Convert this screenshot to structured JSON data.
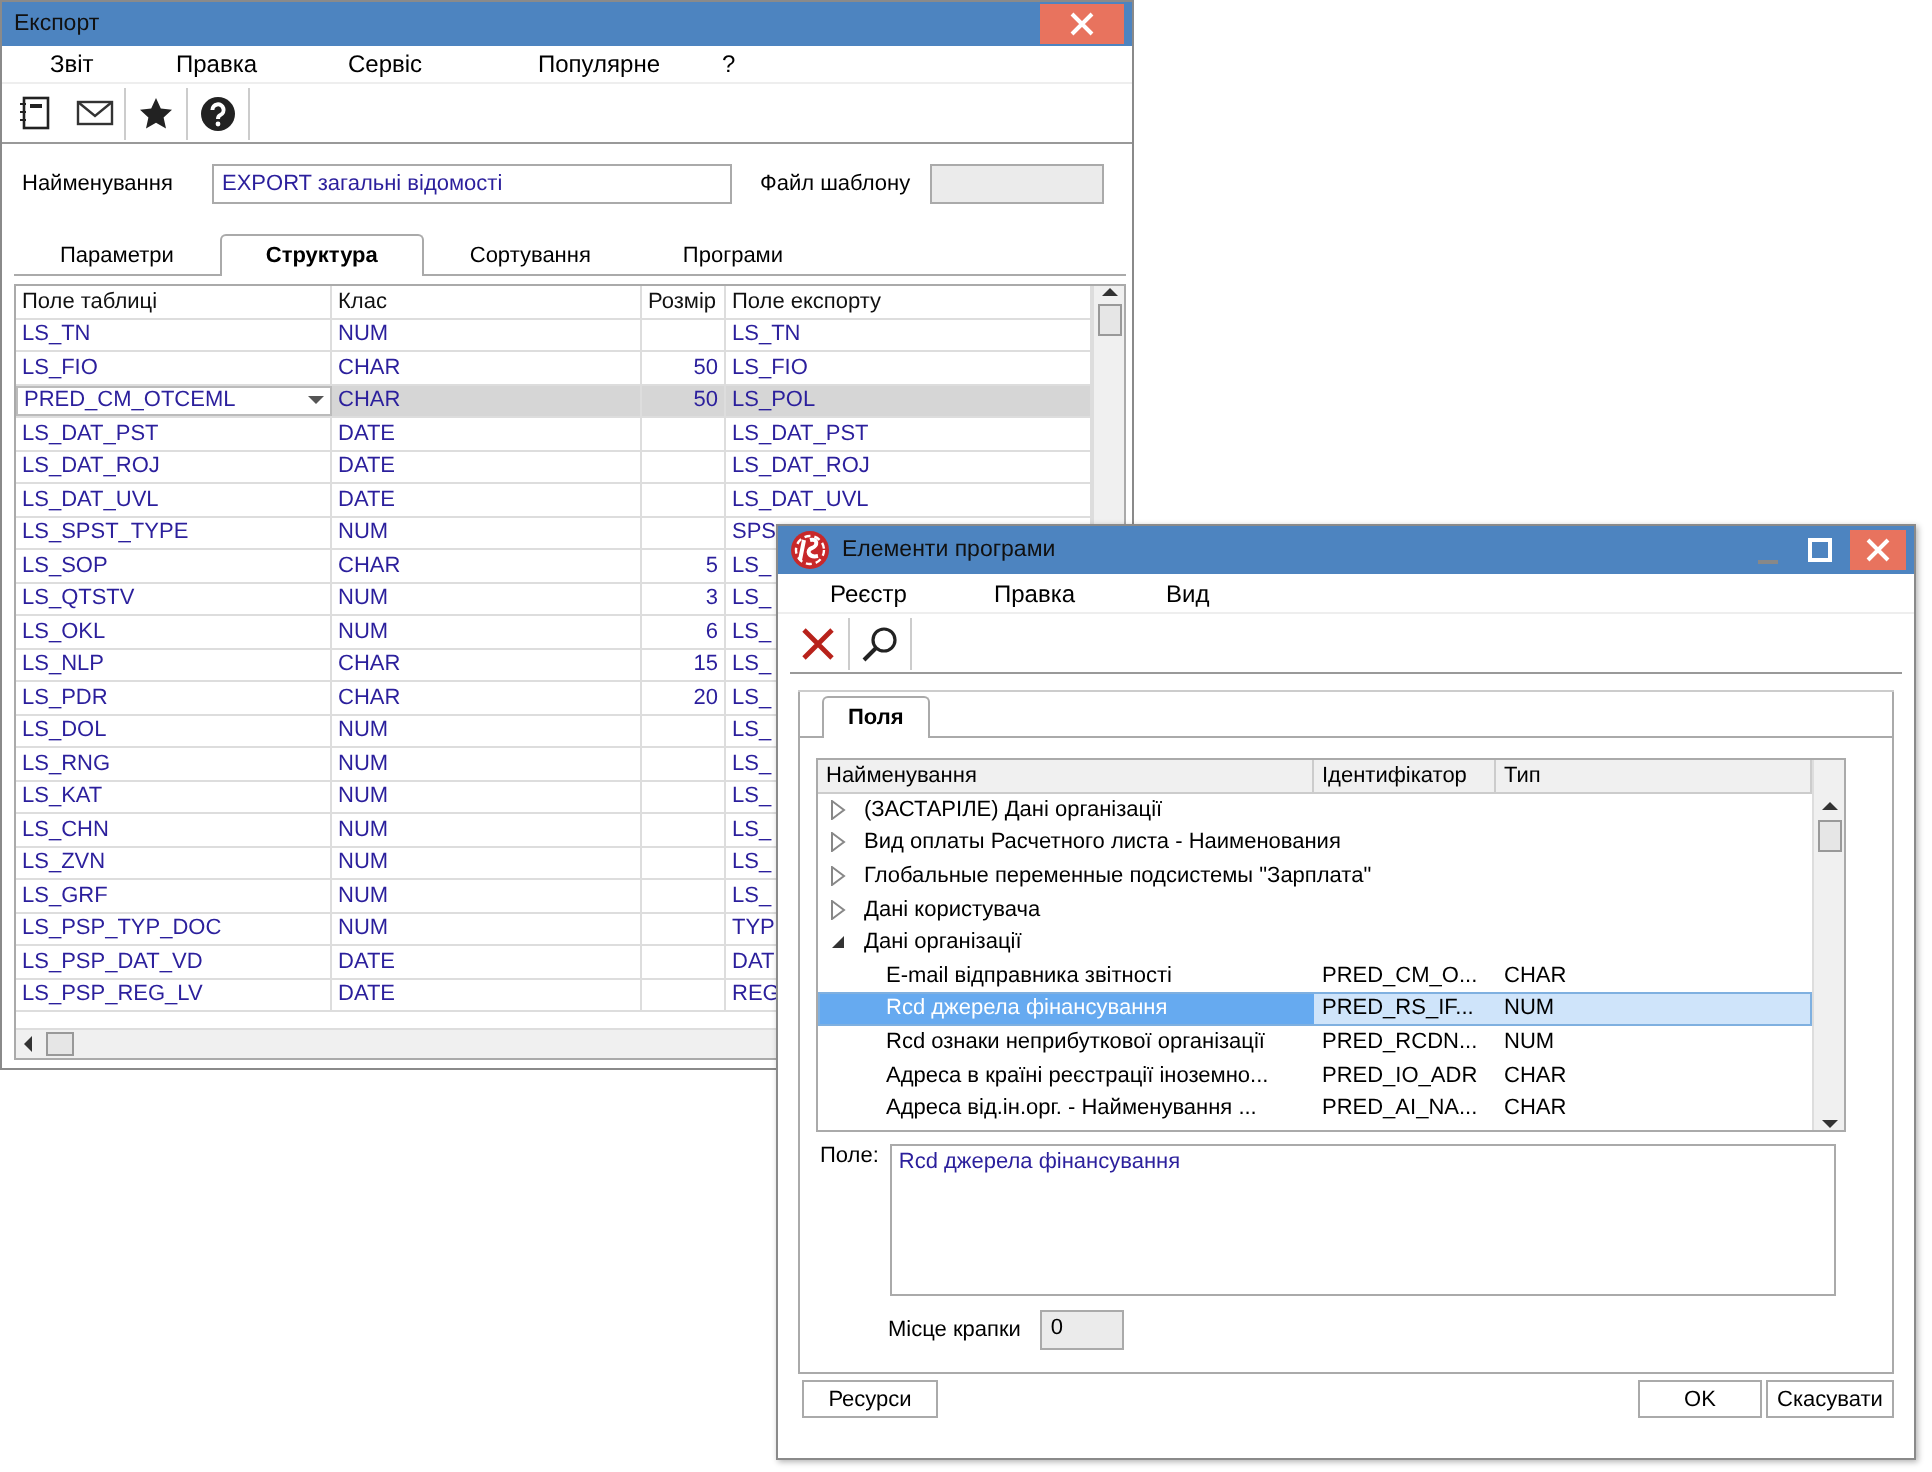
{
  "export_window": {
    "title": "Експорт",
    "menu": [
      "Звіт",
      "Правка",
      "Сервіс",
      "Популярне",
      "?"
    ],
    "name_label": "Найменування",
    "name_value": "EXPORT загальні відомості",
    "template_label": "Файл шаблону",
    "tabs": [
      {
        "label": "Параметри",
        "selected": false
      },
      {
        "label": "Структура",
        "selected": true
      },
      {
        "label": "Сортування",
        "selected": false
      },
      {
        "label": "Програми",
        "selected": false
      }
    ],
    "table": {
      "columns": [
        "Поле таблиці",
        "Клас",
        "Розмір",
        "Поле експорту"
      ],
      "rows": [
        {
          "field": "LS_TN",
          "class": "NUM",
          "export": "LS_TN",
          "selected": false,
          "editing": false
        },
        {
          "field": "LS_FIO",
          "class": "CHAR",
          "size": "50",
          "export": "LS_FIO",
          "selected": false,
          "editing": false
        },
        {
          "field": "PRED_CM_OTCEML",
          "class": "CHAR",
          "size": "50",
          "export": "LS_POL",
          "selected": true,
          "editing": true
        },
        {
          "field": "LS_DAT_PST",
          "class": "DATE",
          "export": "LS_DAT_PST",
          "selected": false,
          "editing": false
        },
        {
          "field": "LS_DAT_ROJ",
          "class": "DATE",
          "export": "LS_DAT_ROJ",
          "selected": false,
          "editing": false
        },
        {
          "field": "LS_DAT_UVL",
          "class": "DATE",
          "export": "LS_DAT_UVL",
          "selected": false,
          "editing": false
        },
        {
          "field": "LS_SPST_TYPE",
          "class": "NUM",
          "export": "SPS",
          "selected": false,
          "editing": false
        },
        {
          "field": "LS_SOP",
          "class": "CHAR",
          "size": "5",
          "export": "LS_",
          "selected": false,
          "editing": false
        },
        {
          "field": "LS_QTSTV",
          "class": "NUM",
          "size": "3",
          "export": "LS_",
          "selected": false,
          "editing": false
        },
        {
          "field": "LS_OKL",
          "class": "NUM",
          "size": "6",
          "export": "LS_",
          "selected": false,
          "editing": false
        },
        {
          "field": "LS_NLP",
          "class": "CHAR",
          "size": "15",
          "export": "LS_",
          "selected": false,
          "editing": false
        },
        {
          "field": "LS_PDR",
          "class": "CHAR",
          "size": "20",
          "export": "LS_",
          "selected": false,
          "editing": false
        },
        {
          "field": "LS_DOL",
          "class": "NUM",
          "export": "LS_",
          "selected": false,
          "editing": false
        },
        {
          "field": "LS_RNG",
          "class": "NUM",
          "export": "LS_",
          "selected": false,
          "editing": false
        },
        {
          "field": "LS_KAT",
          "class": "NUM",
          "export": "LS_",
          "selected": false,
          "editing": false
        },
        {
          "field": "LS_CHN",
          "class": "NUM",
          "export": "LS_",
          "selected": false,
          "editing": false
        },
        {
          "field": "LS_ZVN",
          "class": "NUM",
          "export": "LS_",
          "selected": false,
          "editing": false
        },
        {
          "field": "LS_GRF",
          "class": "NUM",
          "export": "LS_",
          "selected": false,
          "editing": false
        },
        {
          "field": "LS_PSP_TYP_DOC",
          "class": "NUM",
          "export": "TYP",
          "selected": false,
          "editing": false
        },
        {
          "field": "LS_PSP_DAT_VD",
          "class": "DATE",
          "export": "DAT",
          "selected": false,
          "editing": false
        },
        {
          "field": "LS_PSP_REG_LV",
          "class": "DATE",
          "export": "REG",
          "selected": false,
          "editing": false
        }
      ]
    }
  },
  "elements_window": {
    "title": "Елементи програми",
    "menu": [
      "Реєстр",
      "Правка",
      "Вид"
    ],
    "tabs": [
      {
        "label": "Поля",
        "selected": true
      }
    ],
    "tree": {
      "columns": [
        "Найменування",
        "Ідентифікатор",
        "Тип"
      ],
      "items": [
        {
          "name": "(ЗАСТАРІЛЕ) Дані організації",
          "expanded": false,
          "selected": false
        },
        {
          "name": "Вид оплаты Расчетного листа - Наименования",
          "expanded": false,
          "selected": false
        },
        {
          "name": "Глобальные переменные подсистемы \"Зарплата\"",
          "expanded": false,
          "selected": false
        },
        {
          "name": "Дані користувача",
          "expanded": false,
          "selected": false
        },
        {
          "name": "Дані організації",
          "expanded": true,
          "selected": false,
          "children": [
            {
              "name": "E-mail відправника звітності",
              "identifier": "PRED_CM_O...",
              "type": "CHAR",
              "selected": false
            },
            {
              "name": "Rcd джерела фінансування",
              "identifier": "PRED_RS_IF...",
              "type": "NUM",
              "selected": true
            },
            {
              "name": "Rcd ознаки неприбуткової організації",
              "identifier": "PRED_RCDN...",
              "type": "NUM",
              "selected": false
            },
            {
              "name": "Адреса в країні реєстрації іноземно...",
              "identifier": "PRED_IO_ADR",
              "type": "CHAR",
              "selected": false
            },
            {
              "name": "Адреса від.ін.орг. - Найменування ...",
              "identifier": "PRED_AI_NA...",
              "type": "CHAR",
              "selected": false
            }
          ]
        }
      ]
    },
    "field_label": "Поле:",
    "field_value": "Rcd джерела фінансування",
    "decimal_label": "Місце крапки",
    "decimal_value": "0",
    "buttons": [
      {
        "kind": "left",
        "label": "Ресурси"
      },
      {
        "kind": "right",
        "label": "OK"
      },
      {
        "kind": "right",
        "label": "Скасувати"
      }
    ]
  }
}
